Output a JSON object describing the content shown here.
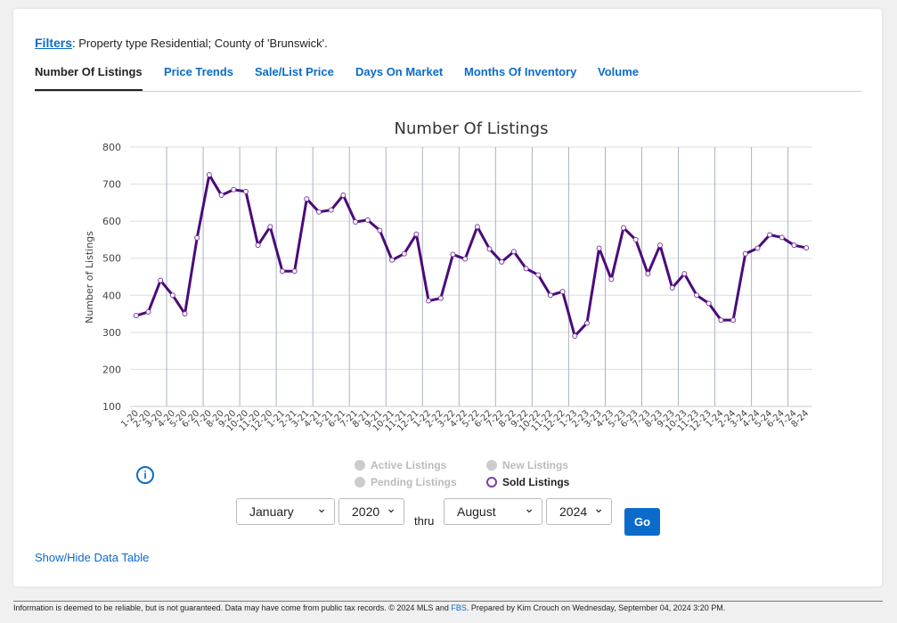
{
  "filters": {
    "link": "Filters",
    "text": ": Property type Residential; County of 'Brunswick'."
  },
  "tabs": [
    "Number Of Listings",
    "Price Trends",
    "Sale/List Price",
    "Days On Market",
    "Months Of Inventory",
    "Volume"
  ],
  "legend": {
    "active": "Active Listings",
    "new": "New Listings",
    "pending": "Pending Listings",
    "sold": "Sold Listings"
  },
  "controls": {
    "from_month": "January",
    "from_year": "2020",
    "thru": "thru",
    "to_month": "August",
    "to_year": "2024",
    "go": "Go"
  },
  "show_hide": "Show/Hide Data Table",
  "footer": {
    "text1": "Information is deemed to be reliable, but is not guaranteed. Data may have come from public tax records. © 2024 MLS and ",
    "fbs": "FBS",
    "text2": ". Prepared by Kim Crouch on Wednesday, September 04, 2024 3:20 PM."
  },
  "colors": {
    "series": "#4b0b7a",
    "accent": "#0b6bcb"
  },
  "chart_data": {
    "type": "line",
    "title": "Number Of Listings",
    "xlabel": "",
    "ylabel": "Number of Listings",
    "ylim": [
      100,
      800
    ],
    "yticks": [
      100,
      200,
      300,
      400,
      500,
      600,
      700,
      800
    ],
    "grid": true,
    "categories": [
      "1-20",
      "2-20",
      "3-20",
      "4-20",
      "5-20",
      "6-20",
      "7-20",
      "8-20",
      "9-20",
      "10-20",
      "11-20",
      "12-20",
      "1-21",
      "2-21",
      "3-21",
      "4-21",
      "5-21",
      "6-21",
      "7-21",
      "8-21",
      "9-21",
      "10-21",
      "11-21",
      "12-21",
      "1-22",
      "2-22",
      "3-22",
      "4-22",
      "5-22",
      "6-22",
      "7-22",
      "8-22",
      "9-22",
      "10-22",
      "11-22",
      "12-22",
      "1-23",
      "2-23",
      "3-23",
      "4-23",
      "5-23",
      "6-23",
      "7-23",
      "8-23",
      "9-23",
      "10-23",
      "11-23",
      "12-23",
      "1-24",
      "2-24",
      "3-24",
      "4-24",
      "5-24",
      "6-24",
      "7-24",
      "8-24"
    ],
    "series": [
      {
        "name": "Sold Listings",
        "values": [
          345,
          355,
          440,
          400,
          350,
          555,
          725,
          670,
          685,
          680,
          535,
          585,
          465,
          465,
          660,
          625,
          630,
          670,
          598,
          603,
          575,
          495,
          512,
          565,
          385,
          392,
          510,
          498,
          585,
          525,
          490,
          518,
          472,
          455,
          400,
          410,
          290,
          325,
          527,
          443,
          582,
          550,
          458,
          535,
          420,
          458,
          400,
          378,
          333,
          333,
          512,
          527,
          563,
          556,
          535,
          528
        ]
      }
    ]
  }
}
